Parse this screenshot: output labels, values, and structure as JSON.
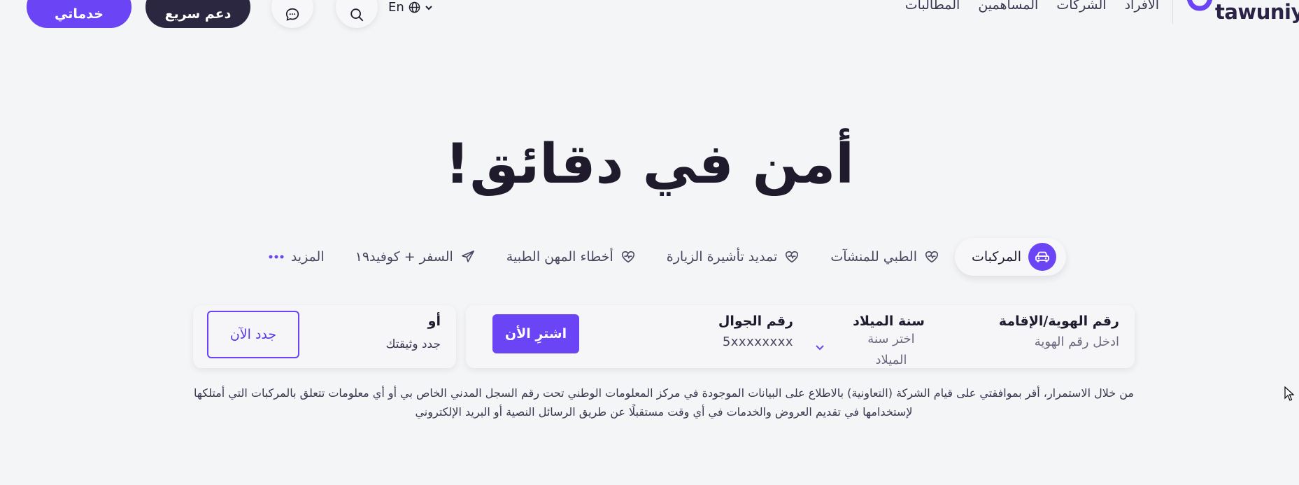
{
  "header": {
    "logo_text": "tawuniya",
    "nav": [
      "الأفراد",
      "الشركات",
      "المساهمين",
      "المطالبات"
    ],
    "lang_label": "En",
    "quick_support_label": "دعم سريع",
    "my_services_label": "خدماتي",
    "icons": [
      "globe-icon",
      "chevron-down-icon",
      "search-icon",
      "chat-icon"
    ]
  },
  "hero": {
    "title": "أمن في دقائق!"
  },
  "tabs": [
    {
      "label": "المركبات",
      "icon": "car-icon",
      "active": true
    },
    {
      "label": "الطبي للمنشآت",
      "icon": "heart-pulse-icon",
      "active": false
    },
    {
      "label": "تمديد تأشيرة الزيارة",
      "icon": "heart-pulse-icon",
      "active": false
    },
    {
      "label": "أخطاء المهن الطبية",
      "icon": "heart-pulse-icon",
      "active": false
    },
    {
      "label": "السفر + كوفيد١٩",
      "icon": "plane-icon",
      "active": false
    },
    {
      "label": "المزيد",
      "icon": "dots-icon",
      "active": false
    }
  ],
  "form": {
    "id_label": "رقم الهوية/الإقامة",
    "id_placeholder": "ادخل رقم الهوية",
    "year_label": "سنة الميلاد",
    "year_placeholder_line1": "اختر سنة",
    "year_placeholder_line2": "الميلاد",
    "phone_label": "رقم الجوال",
    "phone_placeholder": "5xxxxxxxx",
    "buy_label": "اشترِ الأن"
  },
  "renew": {
    "title": "أو",
    "subtitle": "جدد وثيقتك",
    "button_label": "جدد الآن"
  },
  "consent": {
    "line1": "من خلال الاستمرار، أقر بموافقتي على قيام الشركة (التعاونية) بالاطلاع على البيانات الموجودة في مركز المعلومات الوطني تحت رقم السجل المدني الخاص بي أو أي معلومات تتعلق بالمركبات التي أمتلكها",
    "line2": "لإستخدامها في تقديم العروض والخدمات في أي وقت مستقبلًا عن طريق الرسائل النصية أو البريد الإلكتروني"
  },
  "colors": {
    "accent": "#6a44f5",
    "dark": "#2c2740",
    "background": "#f4f5f7"
  }
}
